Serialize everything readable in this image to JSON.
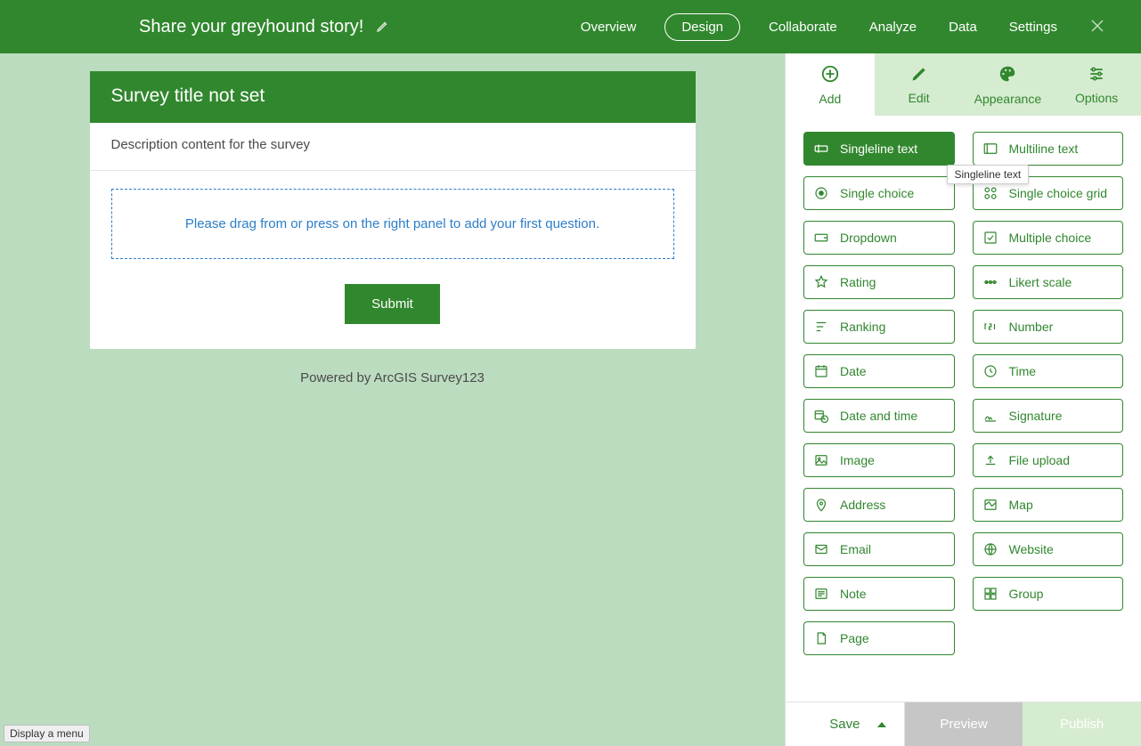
{
  "header": {
    "title": "Share your greyhound story!",
    "nav": {
      "overview": "Overview",
      "design": "Design",
      "collaborate": "Collaborate",
      "analyze": "Analyze",
      "data": "Data",
      "settings": "Settings"
    }
  },
  "survey": {
    "title": "Survey title not set",
    "description": "Description content for the survey",
    "dropzone_hint": "Please drag from or press on the right panel to add your first question.",
    "submit_label": "Submit",
    "powered_by": "Powered by ArcGIS Survey123"
  },
  "panel": {
    "tabs": {
      "add": "Add",
      "edit": "Edit",
      "appearance": "Appearance",
      "options": "Options"
    },
    "tooltip_text": "Singleline text",
    "question_types": {
      "singleline_text": "Singleline text",
      "multiline_text": "Multiline text",
      "single_choice": "Single choice",
      "single_choice_grid": "Single choice grid",
      "dropdown": "Dropdown",
      "multiple_choice": "Multiple choice",
      "rating": "Rating",
      "likert": "Likert scale",
      "ranking": "Ranking",
      "number": "Number",
      "date": "Date",
      "time": "Time",
      "date_time": "Date and time",
      "signature": "Signature",
      "image": "Image",
      "file_upload": "File upload",
      "address": "Address",
      "map": "Map",
      "email": "Email",
      "website": "Website",
      "note": "Note",
      "group": "Group",
      "page": "Page"
    }
  },
  "footer": {
    "save": "Save",
    "preview": "Preview",
    "publish": "Publish"
  },
  "status_bar": "Display a menu"
}
